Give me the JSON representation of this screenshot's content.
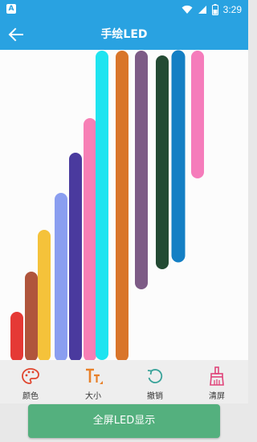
{
  "status_bar": {
    "notification_icon": "A",
    "time": "3:29",
    "icons": [
      "wifi-icon",
      "signal-icon",
      "battery-icon"
    ]
  },
  "app_bar": {
    "title": "手绘LED",
    "back_icon": "arrow-left-icon"
  },
  "canvas": {
    "background": "#fcfcfc",
    "strokes": [
      {
        "color": "#e53935"
      },
      {
        "color": "#b0553c"
      },
      {
        "color": "#f5c23a"
      },
      {
        "color": "#8a9ef0"
      },
      {
        "color": "#4a3a9e"
      },
      {
        "color": "#f77fb5"
      },
      {
        "color": "#1ee4f0"
      },
      {
        "color": "#d9752a"
      },
      {
        "color": "#7d5b86"
      },
      {
        "color": "#234a33"
      },
      {
        "color": "#147fc4"
      },
      {
        "color": "#f57cbb"
      }
    ]
  },
  "toolbar": {
    "items": [
      {
        "label": "颜色",
        "icon": "palette-icon"
      },
      {
        "label": "大小",
        "icon": "text-size-icon"
      },
      {
        "label": "撤销",
        "icon": "undo-icon"
      },
      {
        "label": "清屏",
        "icon": "broom-icon"
      }
    ]
  },
  "action_button": {
    "label": "全屏LED显示",
    "color": "#54b07e"
  }
}
